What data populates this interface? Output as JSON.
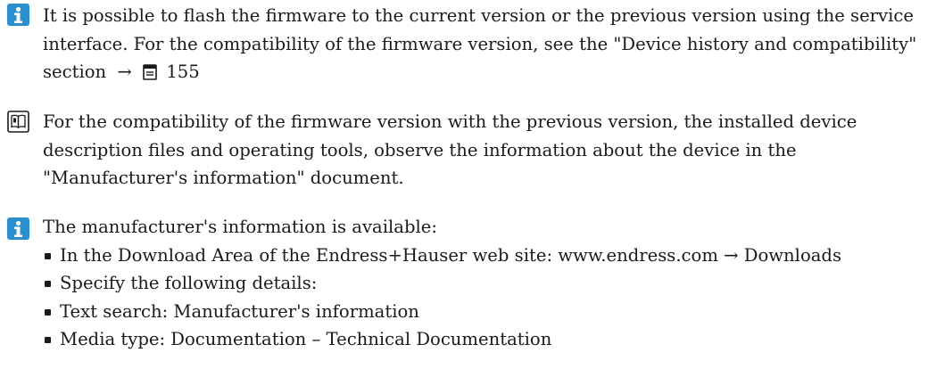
{
  "notes": [
    {
      "icon": "info-icon",
      "text": "It is possible to flash the firmware to the current version or the previous version using the service interface. For the compatibility of the firmware version, see the \"Device history and compatibility\" section",
      "ref_arrow": "→",
      "ref_page": "155"
    },
    {
      "icon": "document-reference-icon",
      "text": "For the compatibility of the firmware version with the previous version, the installed device description files and operating tools, observe the information about the device in the \"Manufacturer's information\" document."
    },
    {
      "icon": "info-icon",
      "text": "The manufacturer's information is available:",
      "items": [
        "In the Download Area of the Endress+Hauser web site: www.endress.com → Downloads",
        "Specify the following details:"
      ],
      "subitems": [
        "Text search: Manufacturer's information",
        "Media type: Documentation – Technical Documentation"
      ]
    }
  ],
  "colors": {
    "info_icon_bg": "#2a8fd0",
    "text": "#1a1a1a"
  }
}
